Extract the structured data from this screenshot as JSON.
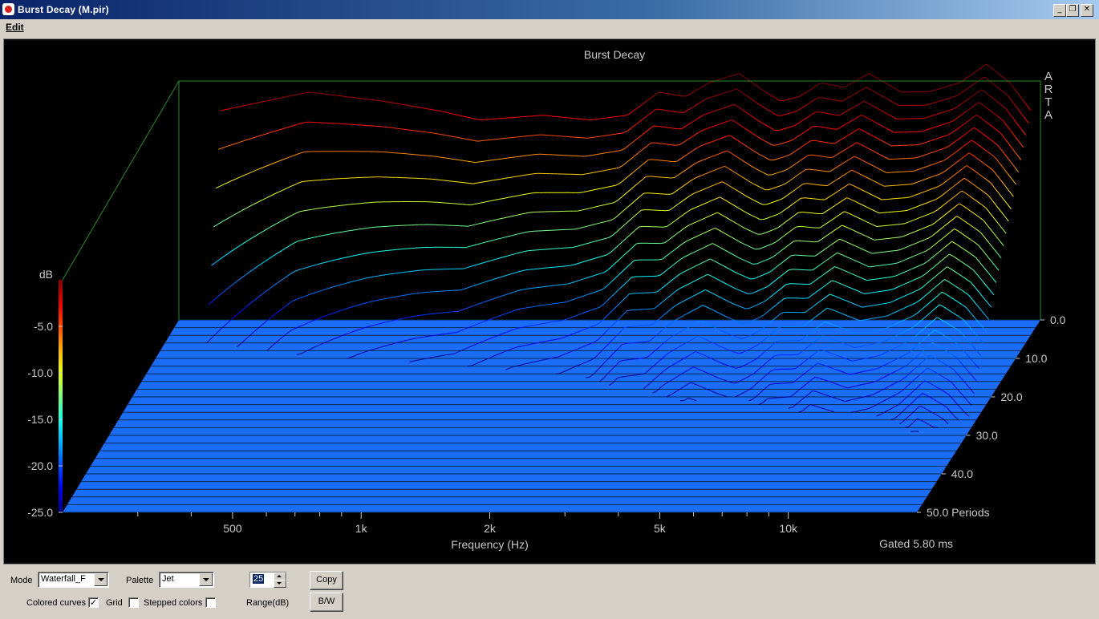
{
  "window": {
    "title": "Burst Decay  (M.pir)",
    "minimize": "_",
    "restore": "❐",
    "close": "✕"
  },
  "menu": {
    "edit": "Edit"
  },
  "chart_data": {
    "type": "waterfall",
    "title": "Burst Decay",
    "watermark": [
      "A",
      "R",
      "T",
      "A"
    ],
    "xlabel": "Frequency (Hz)",
    "x_scale": "log",
    "xlim": [
      200,
      20000
    ],
    "x_ticks": [
      {
        "v": 500,
        "label": "500"
      },
      {
        "v": 1000,
        "label": "1k"
      },
      {
        "v": 2000,
        "label": "2k"
      },
      {
        "v": 5000,
        "label": "5k"
      },
      {
        "v": 10000,
        "label": "10k"
      }
    ],
    "x_minor_ticks": [
      300,
      400,
      600,
      700,
      800,
      900,
      3000,
      4000,
      6000,
      7000,
      8000,
      9000
    ],
    "zlabel": "dB",
    "zlim": [
      -25,
      0
    ],
    "z_ticks": [
      "-5.0",
      "-10.0",
      "-15.0",
      "-20.0",
      "-25.0"
    ],
    "depth_ticks": [
      "0.0",
      "10.0",
      "20.0",
      "30.0",
      "40.0",
      "50.0 Periods"
    ],
    "depth_range": [
      0,
      50
    ],
    "num_slices": 50,
    "palette": "Jet",
    "floor_color": "#1c6df5",
    "gated": "Gated 5.80 ms",
    "front_curve_db": [
      [
        250,
        -16
      ],
      [
        400,
        -14
      ],
      [
        600,
        -15
      ],
      [
        800,
        -16
      ],
      [
        1000,
        -17
      ],
      [
        1400,
        -16.5
      ],
      [
        1800,
        -17
      ],
      [
        2200,
        -16.5
      ],
      [
        2600,
        -14
      ],
      [
        3000,
        -14.5
      ],
      [
        3400,
        -13
      ],
      [
        4000,
        -12
      ],
      [
        4600,
        -14
      ],
      [
        5000,
        -15
      ],
      [
        5500,
        -14.5
      ],
      [
        6200,
        -13
      ],
      [
        7000,
        -13.5
      ],
      [
        8000,
        -12
      ],
      [
        9500,
        -14
      ],
      [
        11000,
        -14
      ],
      [
        13000,
        -13
      ],
      [
        15000,
        -11
      ],
      [
        17000,
        -13
      ],
      [
        19000,
        -16
      ]
    ]
  },
  "controls": {
    "mode_label": "Mode",
    "mode_value": "Waterfall_F",
    "palette_label": "Palette",
    "palette_value": "Jet",
    "range_value": "25",
    "range_label": "Range(dB)",
    "copy_label": "Copy",
    "bw_label": "B/W",
    "colored_curves_label": "Colored curves",
    "colored_curves_checked": "✓",
    "grid_label": "Grid",
    "stepped_colors_label": "Stepped colors"
  }
}
